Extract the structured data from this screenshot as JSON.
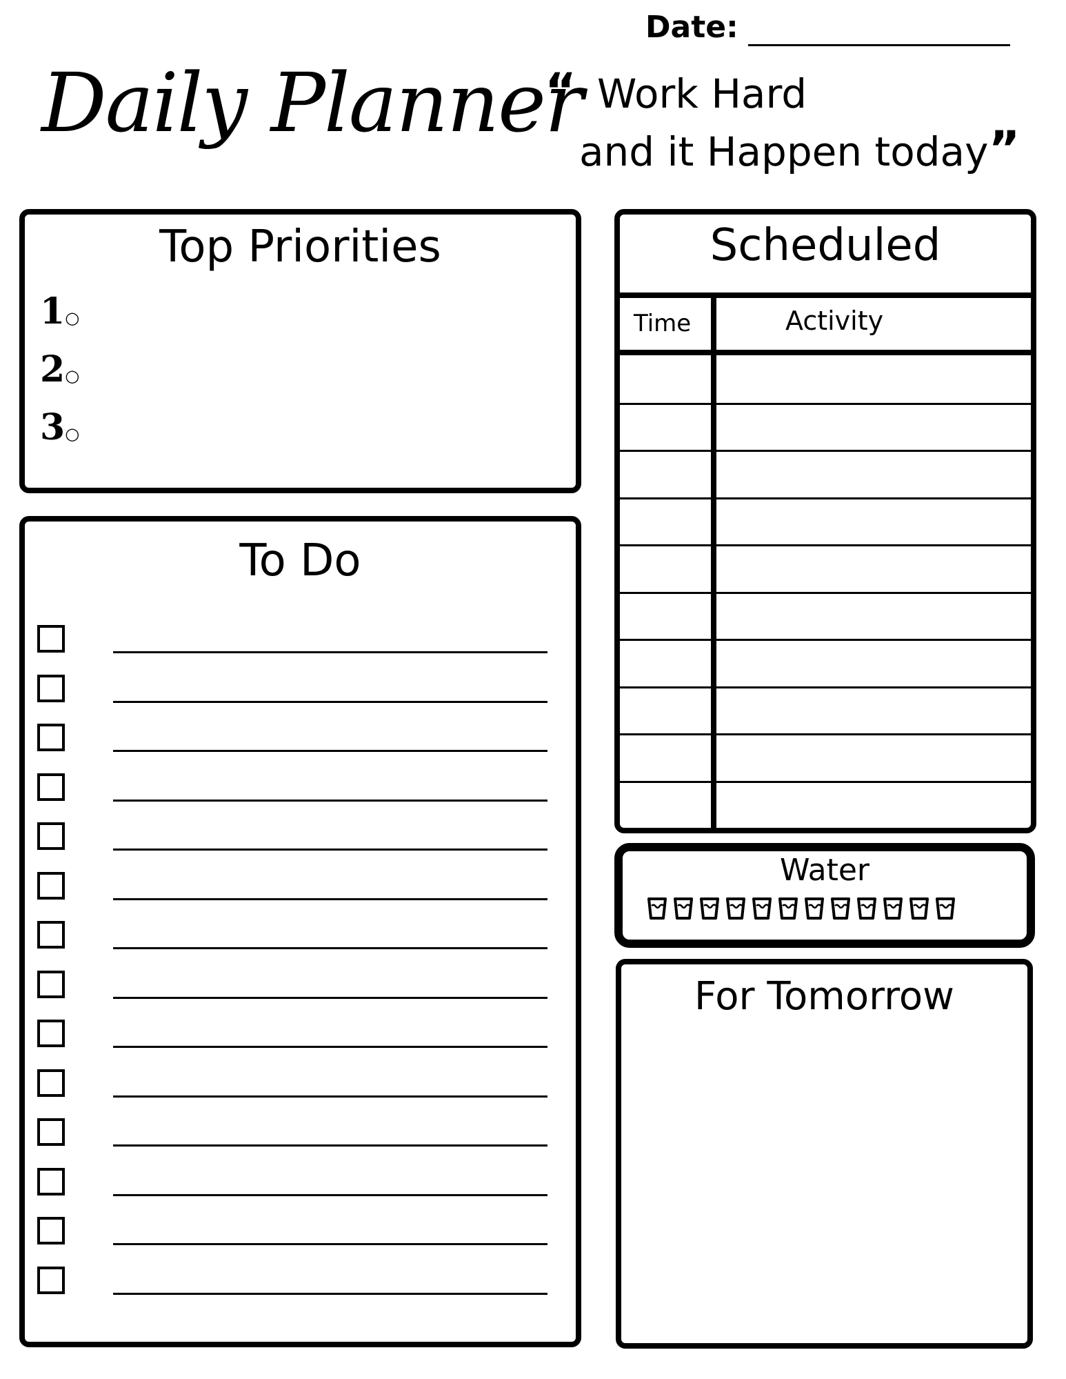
{
  "header": {
    "title": "Daily Planner",
    "date_label": "Date:",
    "date_value": "",
    "quote_open": "“",
    "quote_line1": "Work  Hard",
    "quote_line2": "and  it  Happen today",
    "quote_close": "”"
  },
  "top_priorities": {
    "title": "Top Priorities",
    "items": [
      {
        "number": "1",
        "text": ""
      },
      {
        "number": "2",
        "text": ""
      },
      {
        "number": "3",
        "text": ""
      }
    ]
  },
  "todo": {
    "title": "To Do",
    "items": [
      {
        "checked": false,
        "text": ""
      },
      {
        "checked": false,
        "text": ""
      },
      {
        "checked": false,
        "text": ""
      },
      {
        "checked": false,
        "text": ""
      },
      {
        "checked": false,
        "text": ""
      },
      {
        "checked": false,
        "text": ""
      },
      {
        "checked": false,
        "text": ""
      },
      {
        "checked": false,
        "text": ""
      },
      {
        "checked": false,
        "text": ""
      },
      {
        "checked": false,
        "text": ""
      },
      {
        "checked": false,
        "text": ""
      },
      {
        "checked": false,
        "text": ""
      },
      {
        "checked": false,
        "text": ""
      },
      {
        "checked": false,
        "text": ""
      }
    ]
  },
  "scheduled": {
    "title": "Scheduled",
    "columns": [
      "Time",
      "Activity"
    ],
    "rows": [
      {
        "time": "",
        "activity": ""
      },
      {
        "time": "",
        "activity": ""
      },
      {
        "time": "",
        "activity": ""
      },
      {
        "time": "",
        "activity": ""
      },
      {
        "time": "",
        "activity": ""
      },
      {
        "time": "",
        "activity": ""
      },
      {
        "time": "",
        "activity": ""
      },
      {
        "time": "",
        "activity": ""
      },
      {
        "time": "",
        "activity": ""
      },
      {
        "time": "",
        "activity": ""
      }
    ]
  },
  "water": {
    "title": "Water",
    "cups_total": 12,
    "cups_filled": 0,
    "icon": "water-glass-icon"
  },
  "for_tomorrow": {
    "title": "For Tomorrow",
    "text": ""
  },
  "colors": {
    "ink": "#000000",
    "paper": "#ffffff"
  }
}
